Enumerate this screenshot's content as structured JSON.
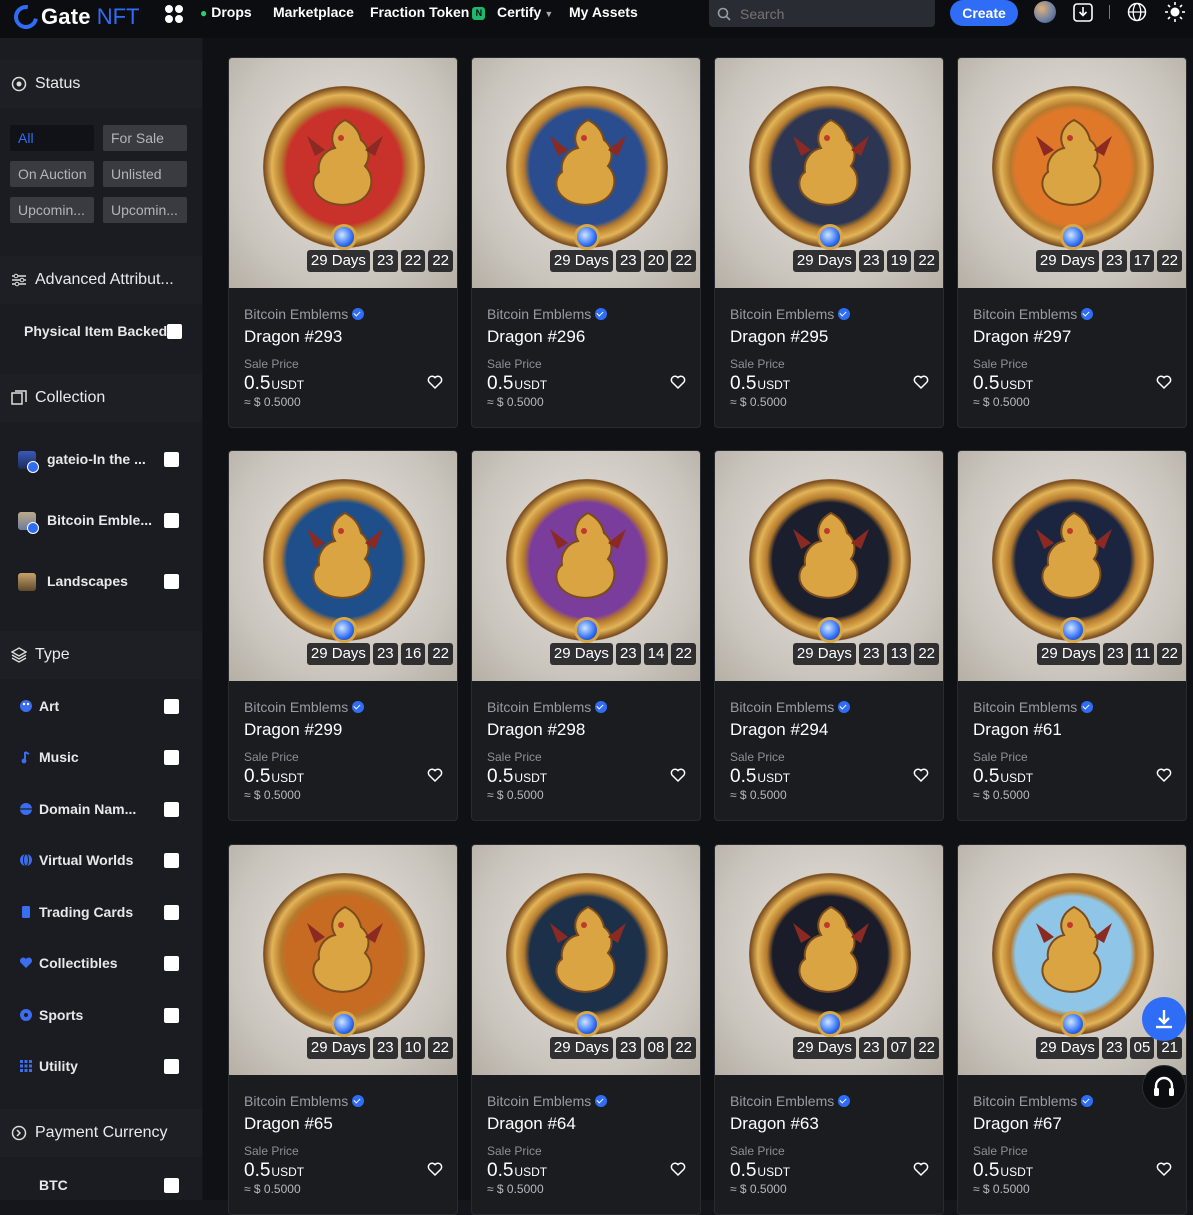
{
  "header": {
    "logo_text": "Gate",
    "logo_sub": "NFT",
    "nav": [
      {
        "label": "Drops"
      },
      {
        "label": "Marketplace"
      },
      {
        "label": "Fraction Token"
      },
      {
        "label": "Certify"
      },
      {
        "label": "My Assets"
      }
    ],
    "search_placeholder": "Search",
    "create_label": "Create"
  },
  "sidebar": {
    "status": {
      "title": "Status",
      "chips": [
        "All",
        "For Sale",
        "On Auction",
        "Unlisted",
        "Upcomin...",
        "Upcomin..."
      ],
      "active": "All"
    },
    "advanced": {
      "title": "Advanced Attribut...",
      "physical_label": "Physical Item Backed"
    },
    "collection": {
      "title": "Collection",
      "items": [
        {
          "label": "gateio-In the ..."
        },
        {
          "label": "Bitcoin Emble..."
        },
        {
          "label": "Landscapes"
        }
      ]
    },
    "type": {
      "title": "Type",
      "items": [
        {
          "label": "Art",
          "icon": "palette-icon"
        },
        {
          "label": "Music",
          "icon": "music-note-icon"
        },
        {
          "label": "Domain Nam...",
          "icon": "domain-icon"
        },
        {
          "label": "Virtual Worlds",
          "icon": "globe-icon"
        },
        {
          "label": "Trading Cards",
          "icon": "card-icon"
        },
        {
          "label": "Collectibles",
          "icon": "heart-gem-icon"
        },
        {
          "label": "Sports",
          "icon": "ball-icon"
        },
        {
          "label": "Utility",
          "icon": "grid-icon"
        }
      ]
    },
    "payment": {
      "title": "Payment Currency",
      "items": [
        {
          "label": "BTC"
        }
      ]
    }
  },
  "common": {
    "collection": "Bitcoin Emblems",
    "sale_label": "Sale Price",
    "price": "0.5",
    "currency": "USDT",
    "usd": "≈ $ 0.5000",
    "days": "29 Days"
  },
  "cards": [
    {
      "name": "Dragon #293",
      "t": [
        "23",
        "22",
        "22"
      ],
      "ring": "#c8322b"
    },
    {
      "name": "Dragon #296",
      "t": [
        "23",
        "20",
        "22"
      ],
      "ring": "#2a4d8f"
    },
    {
      "name": "Dragon #295",
      "t": [
        "23",
        "19",
        "22"
      ],
      "ring": "#2c3552"
    },
    {
      "name": "Dragon #297",
      "t": [
        "23",
        "17",
        "22"
      ],
      "ring": "#e0782a"
    },
    {
      "name": "Dragon #299",
      "t": [
        "23",
        "16",
        "22"
      ],
      "ring": "#1f4f8a"
    },
    {
      "name": "Dragon #298",
      "t": [
        "23",
        "14",
        "22"
      ],
      "ring": "#7a3d9b"
    },
    {
      "name": "Dragon #294",
      "t": [
        "23",
        "13",
        "22"
      ],
      "ring": "#1b1e2c"
    },
    {
      "name": "Dragon #61",
      "t": [
        "23",
        "11",
        "22"
      ],
      "ring": "#1b2540"
    },
    {
      "name": "Dragon #65",
      "t": [
        "23",
        "10",
        "22"
      ],
      "ring": "#c76a22"
    },
    {
      "name": "Dragon #64",
      "t": [
        "23",
        "08",
        "22"
      ],
      "ring": "#1c3049"
    },
    {
      "name": "Dragon #63",
      "t": [
        "23",
        "07",
        "22"
      ],
      "ring": "#1a1c2a"
    },
    {
      "name": "Dragon #67",
      "t": [
        "23",
        "05",
        "21"
      ],
      "ring": "#8fc6e8"
    }
  ]
}
